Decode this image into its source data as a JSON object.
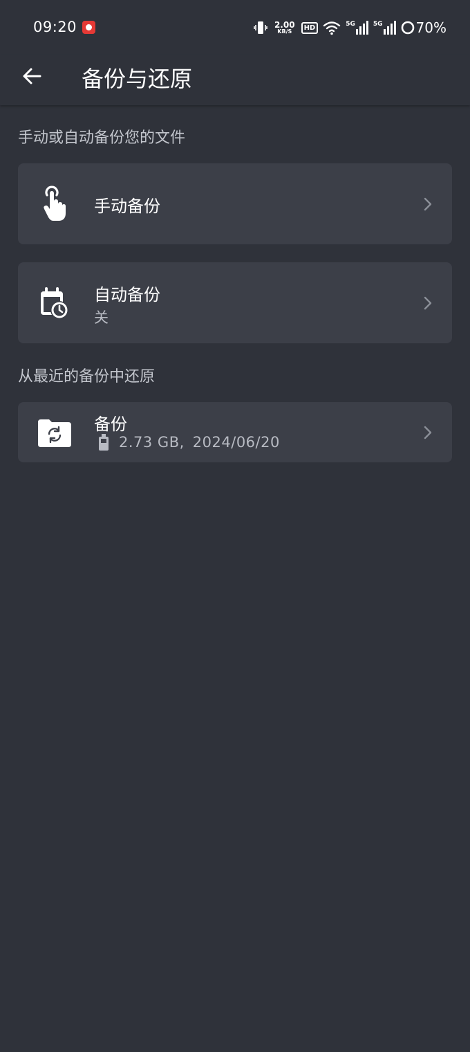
{
  "status_bar": {
    "time": "09:20",
    "net_speed_value": "2.00",
    "net_speed_unit": "KB/S",
    "hd_label": "HD",
    "sim1_label": "5G",
    "sim2_label": "5G",
    "battery_percent": "70%"
  },
  "header": {
    "title": "备份与还原"
  },
  "sections": {
    "manual_auto_header": "手动或自动备份您的文件",
    "restore_header": "从最近的备份中还原"
  },
  "items": {
    "manual_backup": {
      "title": "手动备份",
      "icon": "touch-hand-icon"
    },
    "auto_backup": {
      "title": "自动备份",
      "status": "关",
      "icon": "calendar-clock-icon"
    },
    "backup_record": {
      "title": "备份",
      "size": "2.73 GB,",
      "date": "2024/06/20",
      "icon": "folder-sync-icon"
    }
  },
  "colors": {
    "background": "#2f323a",
    "card": "#3c3f48",
    "primary_text": "#ffffff",
    "secondary_text": "#b8bbc3"
  }
}
